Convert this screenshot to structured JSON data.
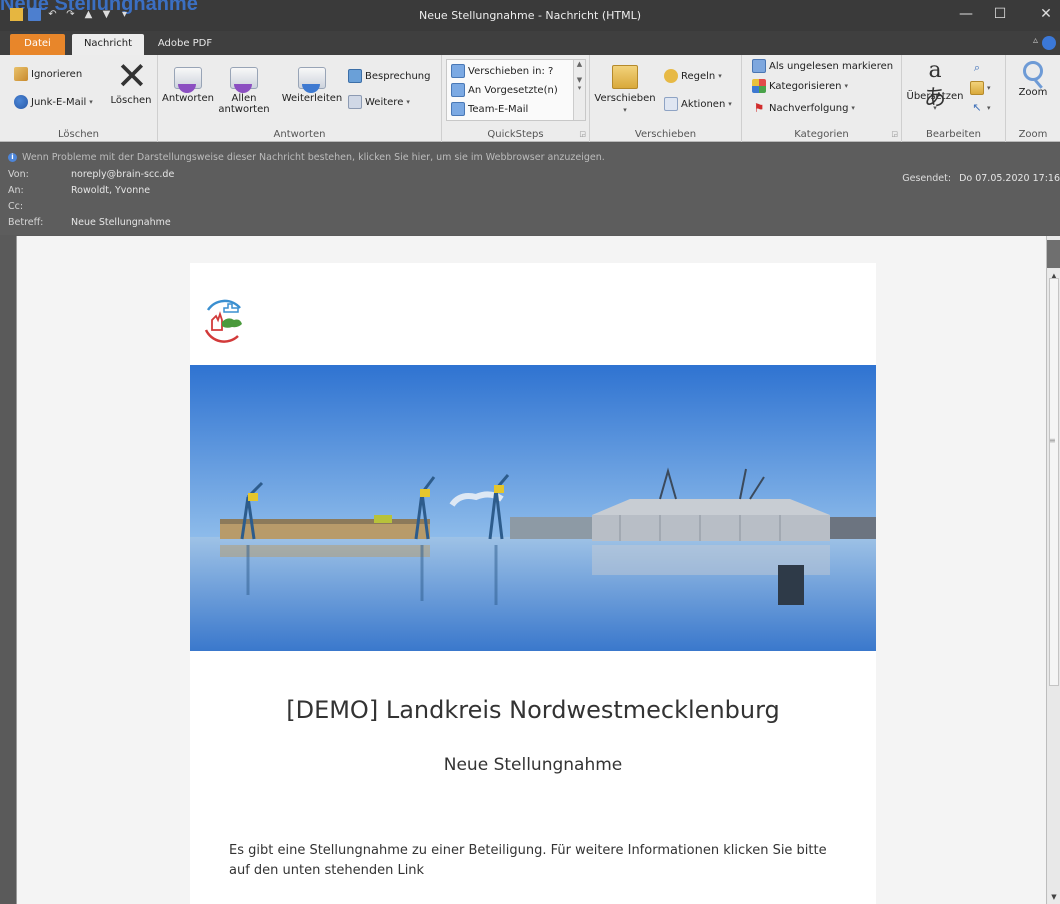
{
  "window": {
    "background_caption": "Neue Stellungnahme",
    "title": "Neue Stellungnahme - Nachricht (HTML)",
    "controls": {
      "minimize": "—",
      "maximize": "☐",
      "close": "✕"
    }
  },
  "ribbon": {
    "tabs": [
      "Datei",
      "Nachricht",
      "Adobe PDF"
    ],
    "groups": {
      "loeschen": {
        "label": "Löschen",
        "ignore": "Ignorieren",
        "junk": "Junk-E-Mail",
        "delete": "Löschen"
      },
      "antworten": {
        "label": "Antworten",
        "reply": "Antworten",
        "reply_all": "Allen antworten",
        "forward": "Weiterleiten",
        "meeting": "Besprechung",
        "more": "Weitere"
      },
      "quicksteps": {
        "label": "QuickSteps",
        "items": [
          "Verschieben in: ?",
          "An Vorgesetzte(n)",
          "Team-E-Mail"
        ]
      },
      "verschieben": {
        "label": "Verschieben",
        "move": "Verschieben",
        "rules": "Regeln",
        "actions": "Aktionen"
      },
      "kategorien": {
        "label": "Kategorien",
        "unread": "Als ungelesen markieren",
        "categorize": "Kategorisieren",
        "followup": "Nachverfolgung"
      },
      "bearbeiten": {
        "label": "Bearbeiten",
        "translate": "Übersetzen"
      },
      "zoom": {
        "label": "Zoom",
        "zoom": "Zoom"
      }
    }
  },
  "message": {
    "infobar": "Wenn Probleme mit der Darstellungsweise dieser Nachricht bestehen, klicken Sie hier, um sie im Webbrowser anzuzeigen.",
    "from_label": "Von:",
    "from": "noreply@brain-scc.de",
    "to_label": "An:",
    "to": "Rowoldt, Yvonne",
    "cc_label": "Cc:",
    "subject_label": "Betreff:",
    "subject": "Neue Stellungnahme",
    "sent_label": "Gesendet:",
    "sent": "Do 07.05.2020 17:16"
  },
  "email": {
    "org_title": "[DEMO] Landkreis Nordwestmecklenburg",
    "heading": "Neue Stellungnahme",
    "body": "Es gibt eine Stellungnahme zu einer Beteiligung. Für weitere Informationen klicken Sie bitte auf den unten stehenden Link"
  },
  "colors": {
    "accent_orange": "#e8862a",
    "ribbon_bg": "#ececec",
    "header_bg": "#5d5d5d",
    "sky_blue": "#3d7ed6"
  },
  "icons": [
    "ignore-icon",
    "junk-icon",
    "delete-icon",
    "reply-icon",
    "reply-all-icon",
    "forward-icon",
    "meeting-icon",
    "quickstep-icon",
    "move-icon",
    "rules-icon",
    "actions-icon",
    "unread-icon",
    "categorize-icon",
    "followup-flag-icon",
    "translate-icon",
    "find-icon",
    "zoom-icon",
    "info-icon",
    "logo-icon"
  ]
}
